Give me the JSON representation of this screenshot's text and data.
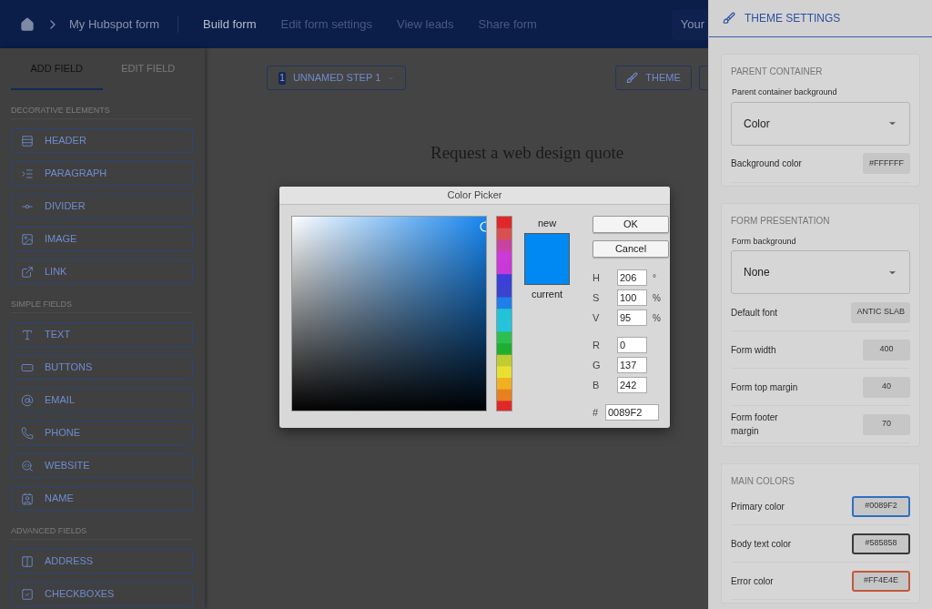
{
  "top_bar": {
    "breadcrumb": "My Hubspot form",
    "nav": [
      {
        "label": "Build form",
        "selected": true
      },
      {
        "label": "Edit form settings",
        "selected": false
      },
      {
        "label": "View leads",
        "selected": false
      },
      {
        "label": "Share form",
        "selected": false
      }
    ],
    "account": "Your"
  },
  "sidebar": {
    "tabs": [
      {
        "label": "ADD FIELD",
        "selected": true
      },
      {
        "label": "EDIT FIELD",
        "selected": false
      }
    ],
    "sections": [
      {
        "title": "DECORATIVE ELEMENTS",
        "fields": [
          {
            "kind": "header",
            "label": "HEADER"
          },
          {
            "kind": "paragraph",
            "label": "PARAGRAPH"
          },
          {
            "kind": "divider",
            "label": "DIVIDER"
          },
          {
            "kind": "image",
            "label": "IMAGE"
          },
          {
            "kind": "link",
            "label": "LINK"
          }
        ]
      },
      {
        "title": "SIMPLE FIELDS",
        "fields": [
          {
            "kind": "text",
            "label": "TEXT"
          },
          {
            "kind": "buttons",
            "label": "BUTTONS"
          },
          {
            "kind": "email",
            "label": "EMAIL"
          },
          {
            "kind": "phone",
            "label": "PHONE"
          },
          {
            "kind": "website",
            "label": "WEBSITE"
          },
          {
            "kind": "name",
            "label": "NAME"
          }
        ]
      },
      {
        "title": "ADVANCED FIELDS",
        "fields": [
          {
            "kind": "address",
            "label": "ADDRESS"
          },
          {
            "kind": "checkboxes",
            "label": "CHECKBOXES"
          }
        ]
      }
    ]
  },
  "canvas": {
    "step": {
      "number": "1",
      "label": "UNNAMED STEP 1"
    },
    "theme_button": "THEME",
    "form_title": "Request a web design quote"
  },
  "color_picker": {
    "title": "Color Picker",
    "new_label": "new",
    "current_label": "current",
    "buttons": [
      "OK",
      "Cancel"
    ],
    "fields": [
      {
        "label": "H",
        "value": "206",
        "unit": "°"
      },
      {
        "label": "S",
        "value": "100",
        "unit": "%"
      },
      {
        "label": "V",
        "value": "95",
        "unit": "%"
      },
      {
        "label": "R",
        "value": "0"
      },
      {
        "label": "G",
        "value": "137"
      },
      {
        "label": "B",
        "value": "242"
      }
    ],
    "hex": {
      "label": "#",
      "value": "0089F2"
    }
  },
  "theme_panel": {
    "title": "THEME SETTINGS",
    "sections": [
      {
        "title": "PARENT CONTAINER",
        "rows": [
          {
            "kind": "select",
            "label": "Parent container background",
            "value": "Color"
          },
          {
            "kind": "value",
            "label": "Background color",
            "value": "#FFFFFF"
          }
        ]
      },
      {
        "title": "FORM PRESENTATION",
        "rows": [
          {
            "kind": "select",
            "label": "Form background",
            "value": "None"
          },
          {
            "kind": "value",
            "label": "Default font",
            "value": "ANTIC SLAB"
          },
          {
            "kind": "value",
            "label": "Form width",
            "value": "400"
          },
          {
            "kind": "value",
            "label": "Form top margin",
            "value": "40"
          },
          {
            "kind": "value",
            "label": "Form footer margin",
            "value": "70"
          }
        ]
      },
      {
        "title": "MAIN COLORS",
        "rows": [
          {
            "kind": "color",
            "label": "Primary color",
            "value": "#0089F2",
            "color": "#2f6fc4"
          },
          {
            "kind": "color",
            "label": "Body text color",
            "value": "#585858",
            "color": "#3a3a3a"
          },
          {
            "kind": "color",
            "label": "Error color",
            "value": "#FF4E4E",
            "color": "#c2583f"
          }
        ]
      }
    ]
  }
}
